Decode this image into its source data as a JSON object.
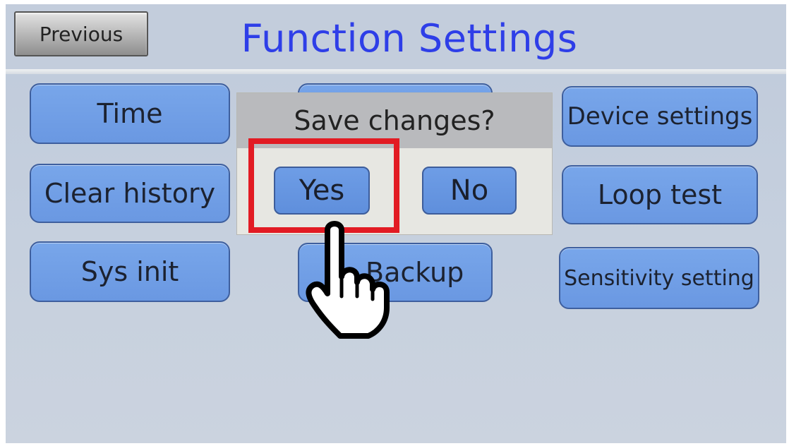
{
  "header": {
    "previous_label": "Previous",
    "title": "Function Settings"
  },
  "buttons": {
    "time": "Time",
    "clear_history": "Clear history",
    "sys_init": "Sys init",
    "backup": "Backup",
    "device_settings": "Device settings",
    "loop_test": "Loop test",
    "sensitivity_setting": "Sensitivity setting"
  },
  "dialog": {
    "question": "Save changes?",
    "yes_label": "Yes",
    "no_label": "No"
  },
  "annotation": {
    "highlight_color": "#e21b23",
    "pointer_icon": "hand-pointer-icon"
  },
  "colors": {
    "title": "#2e3ee8",
    "button_fill": "#78a6ea",
    "screen_bg": "#c3cddc"
  }
}
